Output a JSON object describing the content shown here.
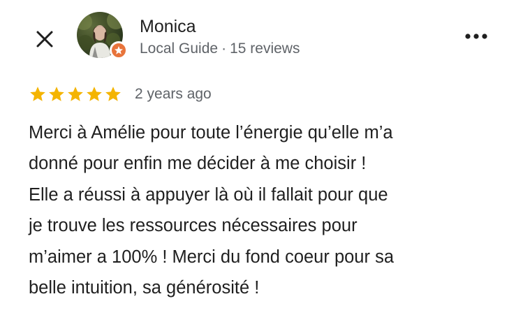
{
  "header": {
    "close_icon": "close-icon",
    "more_icon": "more-horizontal-icon",
    "reviewer": {
      "name": "Monica",
      "badge_icon": "local-guide-badge-icon",
      "role": "Local Guide",
      "separator": "·",
      "reviews_count": "15 reviews"
    }
  },
  "review": {
    "rating": 5,
    "rating_max": 5,
    "star_icon": "star-icon",
    "time": "2 years ago",
    "text": "Merci à Amélie pour toute l’énergie qu’elle m’a\ndonné pour enfin me décider à me choisir !\nElle a réussi à appuyer là où il fallait pour que\nje trouve les ressources nécessaires pour\nm’aimer a 100% ! Merci du fond coeur pour sa\nbelle intuition, sa générosité !"
  },
  "colors": {
    "star": "#f4b400",
    "badge": "#e8743b",
    "text_primary": "#1f1f1f",
    "text_secondary": "#5f6368"
  }
}
